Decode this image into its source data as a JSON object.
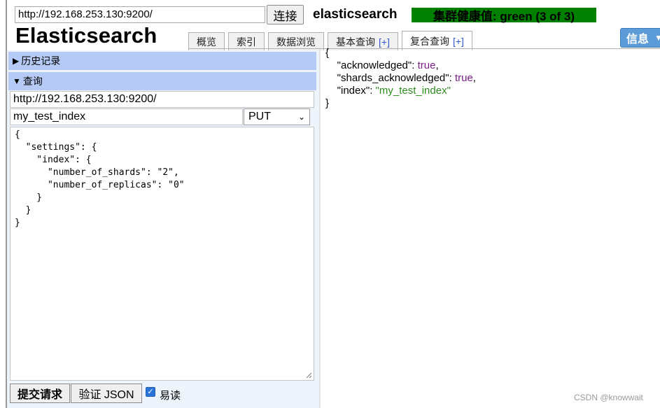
{
  "toolbar": {
    "url_value": "http://192.168.253.130:9200/",
    "connect_label": "连接",
    "cluster_name": "elasticsearch",
    "health_status": "集群健康值: green (3 of 3)",
    "health_color": "#008000"
  },
  "app": {
    "title": "Elasticsearch"
  },
  "tabs": [
    {
      "label": "概览",
      "plus": ""
    },
    {
      "label": "索引",
      "plus": ""
    },
    {
      "label": "数据浏览",
      "plus": ""
    },
    {
      "label": "基本查询",
      "plus": "[+]"
    },
    {
      "label": "复合查询",
      "plus": "[+]"
    }
  ],
  "info_button": {
    "label": "信息"
  },
  "sections": {
    "history": {
      "label": "历史记录",
      "icon": "triangle-right-icon"
    },
    "query": {
      "label": "查询",
      "icon": "triangle-down-icon"
    }
  },
  "query_form": {
    "base_url": "http://192.168.253.130:9200/",
    "path": "my_test_index",
    "method": "PUT",
    "body": "{\n  \"settings\": {\n    \"index\": {\n      \"number_of_shards\": \"2\",\n      \"number_of_replicas\": \"0\"\n    }\n  }\n}"
  },
  "actions": {
    "submit_label": "提交请求",
    "validate_label": "验证 JSON",
    "pretty_label": "易读",
    "pretty_checked": true
  },
  "result": {
    "open": "{",
    "close": "}",
    "lines": [
      {
        "key": "\"acknowledged\"",
        "value": "true",
        "kind": "bool",
        "sep": ","
      },
      {
        "key": "\"shards_acknowledged\"",
        "value": "true",
        "kind": "bool",
        "sep": ","
      },
      {
        "key": "\"index\"",
        "value": "\"my_test_index\"",
        "kind": "string",
        "sep": ""
      }
    ]
  },
  "watermark": "CSDN @knowwait"
}
